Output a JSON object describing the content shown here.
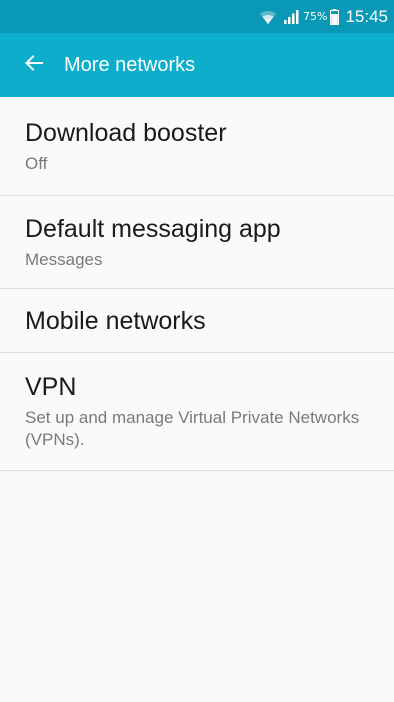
{
  "status_bar": {
    "battery_percent": "75%",
    "time": "15:45",
    "icons": [
      "wifi-icon",
      "signal-icon",
      "battery-icon"
    ]
  },
  "app_bar": {
    "title": "More networks",
    "back_icon": "arrow-left-icon"
  },
  "settings": [
    {
      "title": "Download booster",
      "subtitle": "Off"
    },
    {
      "title": "Default messaging app",
      "subtitle": "Messages"
    },
    {
      "title": "Mobile networks",
      "subtitle": ""
    },
    {
      "title": "VPN",
      "subtitle": "Set up and manage Virtual Private Networks (VPNs)."
    }
  ],
  "colors": {
    "status_bar": "#0a98b7",
    "app_bar": "#0caecb",
    "background": "#fafafa"
  }
}
